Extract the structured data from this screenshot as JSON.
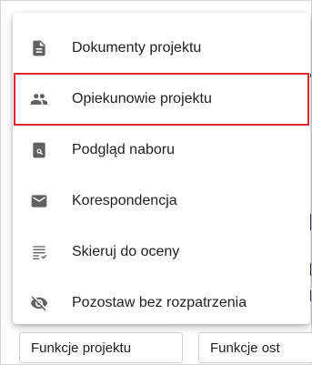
{
  "menu": {
    "items": [
      {
        "label": "Dokumenty projektu",
        "icon": "document-icon"
      },
      {
        "label": "Opiekunowie projektu",
        "icon": "people-icon",
        "highlighted": true
      },
      {
        "label": "Podgląd naboru",
        "icon": "search-document-icon"
      },
      {
        "label": "Korespondencja",
        "icon": "mail-icon"
      },
      {
        "label": "Skieruj do oceny",
        "icon": "checklist-icon"
      },
      {
        "label": "Pozostaw bez rozpatrzenia",
        "icon": "visibility-off-icon"
      }
    ]
  },
  "buttons": {
    "project_functions": "Funkcje projektu",
    "other_functions": "Funkcje ost"
  },
  "colors": {
    "highlight_border": "#e0282a",
    "icon": "#616161",
    "text": "#212121"
  }
}
